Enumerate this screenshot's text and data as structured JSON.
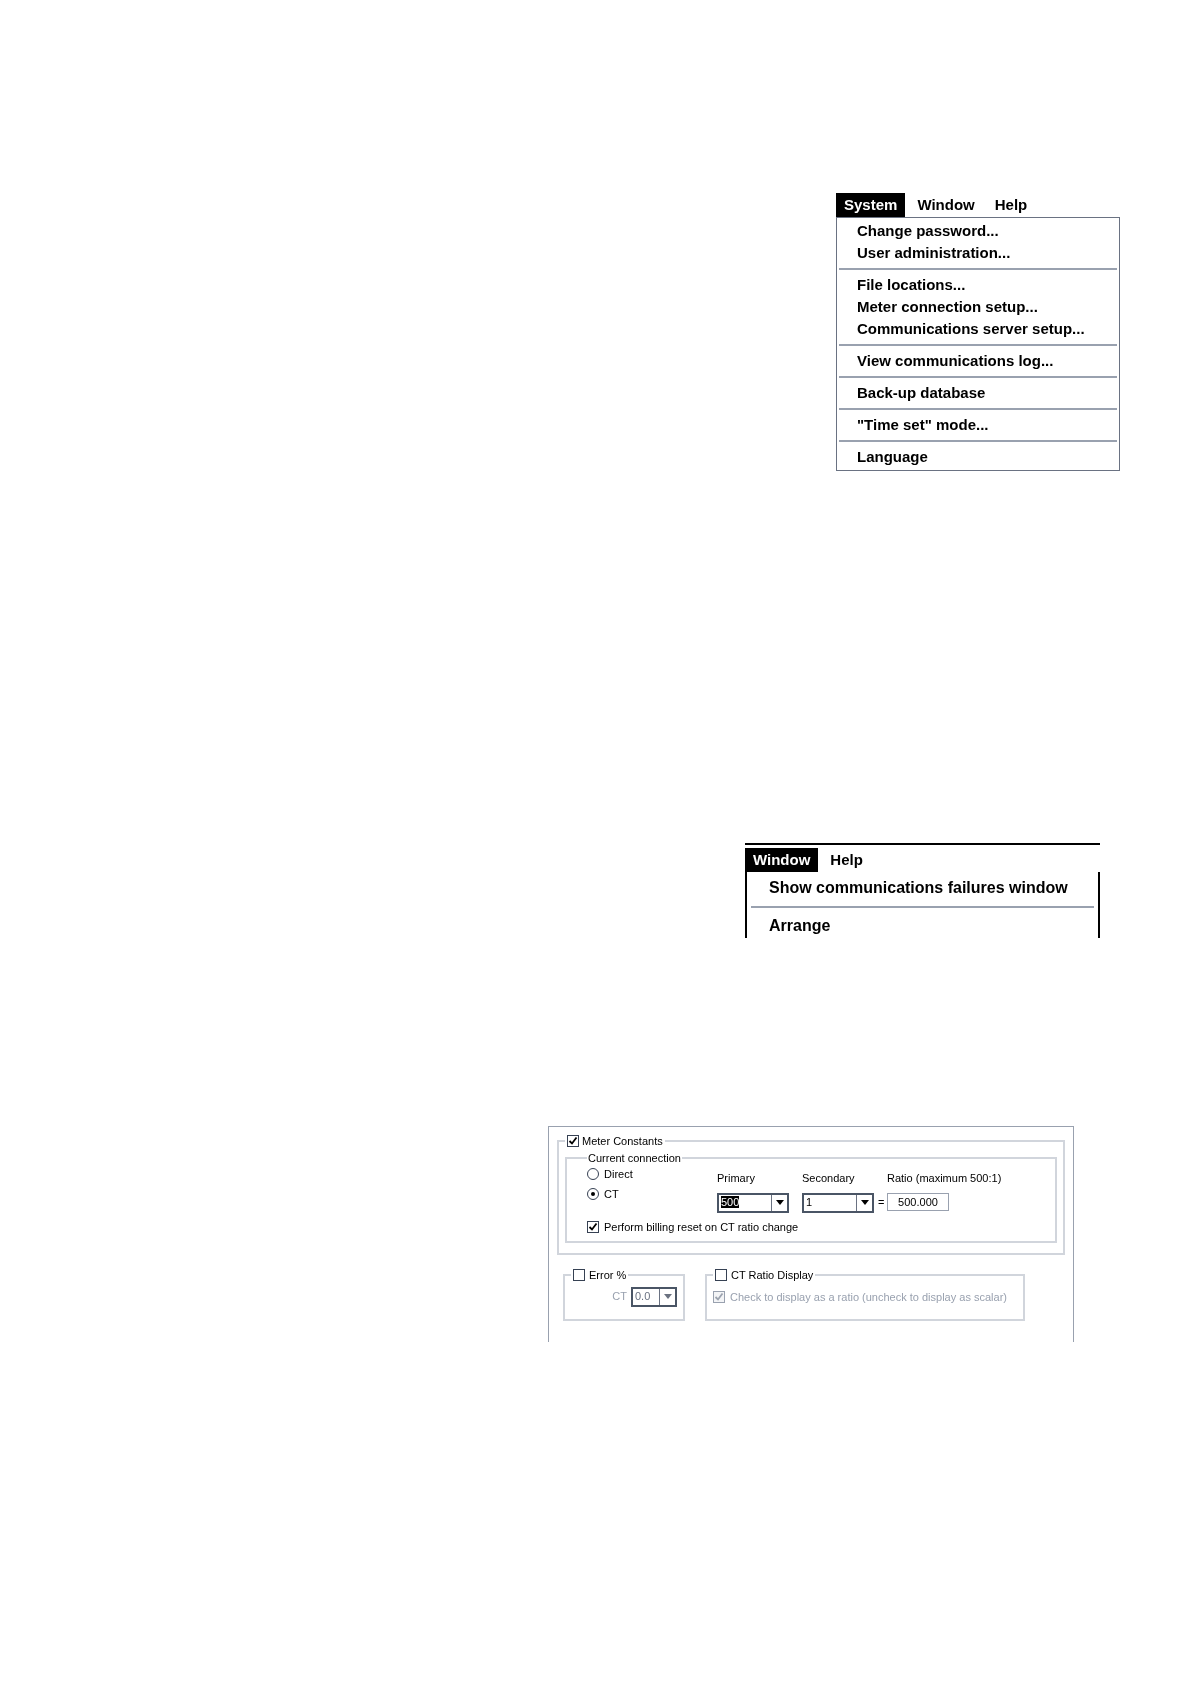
{
  "system_menu": {
    "menu_bar": [
      {
        "label": "System",
        "selected": true
      },
      {
        "label": "Window",
        "selected": false
      },
      {
        "label": "Help",
        "selected": false
      }
    ],
    "groups": [
      {
        "items": [
          "Change password...",
          "User administration..."
        ]
      },
      {
        "items": [
          "File locations...",
          "Meter connection setup...",
          "Communications server setup..."
        ]
      },
      {
        "items": [
          "View communications log..."
        ]
      },
      {
        "items": [
          "Back-up database"
        ]
      },
      {
        "items": [
          "\"Time set\" mode..."
        ]
      },
      {
        "items": [
          "Language"
        ]
      }
    ]
  },
  "window_menu": {
    "menu_bar": [
      {
        "label": "Window",
        "selected": true
      },
      {
        "label": "Help",
        "selected": false
      }
    ],
    "groups": [
      {
        "items": [
          "Show communications failures window"
        ]
      },
      {
        "items": [
          "Arrange"
        ]
      }
    ]
  },
  "dialog": {
    "meter_constants": {
      "label": "Meter Constants",
      "checked": true,
      "current_connection": {
        "title": "Current connection",
        "options": [
          {
            "label": "Direct",
            "selected": false
          },
          {
            "label": "CT",
            "selected": true
          }
        ],
        "primary": {
          "label": "Primary",
          "value": "500"
        },
        "secondary": {
          "label": "Secondary",
          "value": "1"
        },
        "equals": "=",
        "ratio": {
          "label": "Ratio (maximum 500:1)",
          "value": "500.000"
        },
        "billing_reset": {
          "label": "Perform billing reset on CT ratio change",
          "checked": true
        }
      }
    },
    "error_percent": {
      "label": "Error %",
      "checked": false,
      "ct": {
        "label": "CT",
        "value": "0.0",
        "disabled": true
      }
    },
    "ct_ratio_display": {
      "label": "CT Ratio Display",
      "checked": false,
      "option": {
        "label": "Check to display as a ratio (uncheck to display as scalar)",
        "checked": true,
        "disabled": true
      }
    }
  }
}
